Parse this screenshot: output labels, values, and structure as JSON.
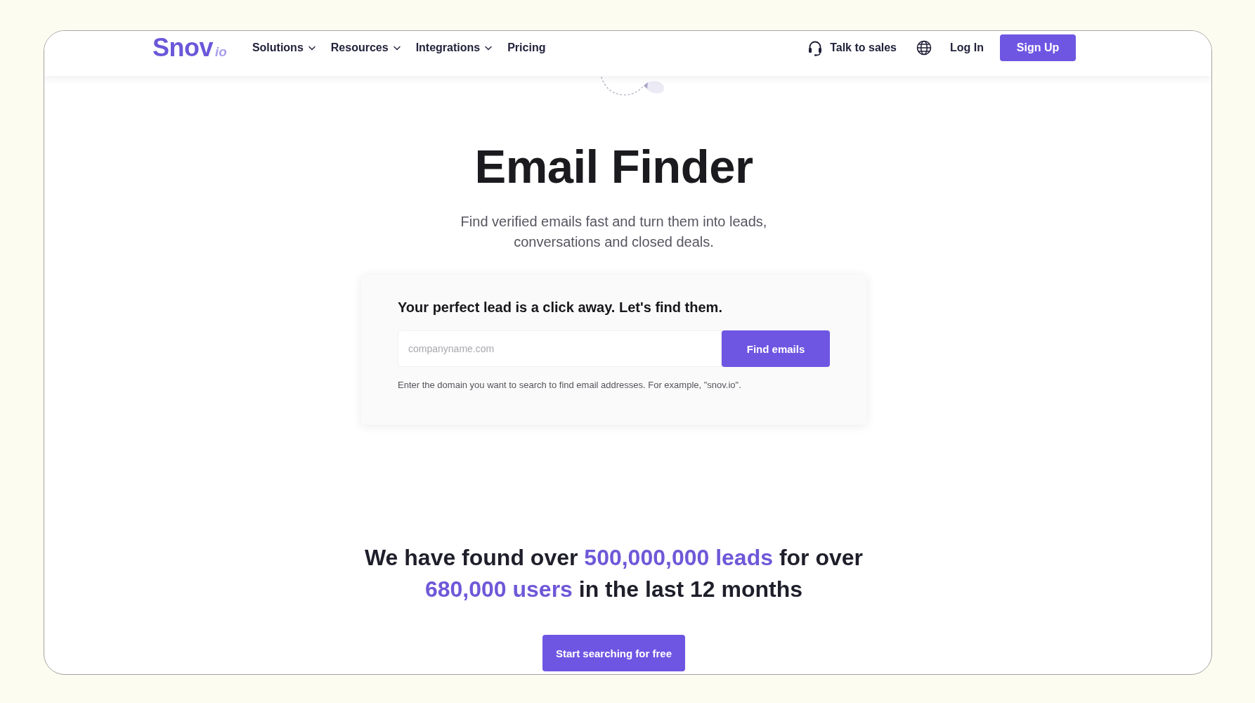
{
  "logo": {
    "name": "Snov",
    "suffix": "io"
  },
  "nav": [
    {
      "label": "Solutions",
      "has_menu": true
    },
    {
      "label": "Resources",
      "has_menu": true
    },
    {
      "label": "Integrations",
      "has_menu": true
    },
    {
      "label": "Pricing",
      "has_menu": false
    }
  ],
  "header_actions": {
    "talk_to_sales": "Talk to sales",
    "log_in": "Log In",
    "sign_up": "Sign Up"
  },
  "hero": {
    "title": "Email Finder",
    "subtitle_lines": [
      "Find verified emails fast and turn them into leads,",
      "conversations and closed deals."
    ]
  },
  "search_card": {
    "heading": "Your perfect lead is a click away. Let's find them.",
    "input": {
      "placeholder": "companyname.com"
    },
    "button": "Find emails",
    "hint": "Enter the domain you want to search to find email addresses. For example, \"snov.io\"."
  },
  "stats": {
    "segments": [
      {
        "text": "We have found over ",
        "highlight": false
      },
      {
        "text": "500,000,000 leads",
        "highlight": true
      },
      {
        "text": " for over ",
        "highlight": false
      },
      {
        "text": "680,000 users",
        "highlight": true
      },
      {
        "text": " in the last 12 months",
        "highlight": false
      }
    ]
  },
  "cta": "Start searching for free"
}
